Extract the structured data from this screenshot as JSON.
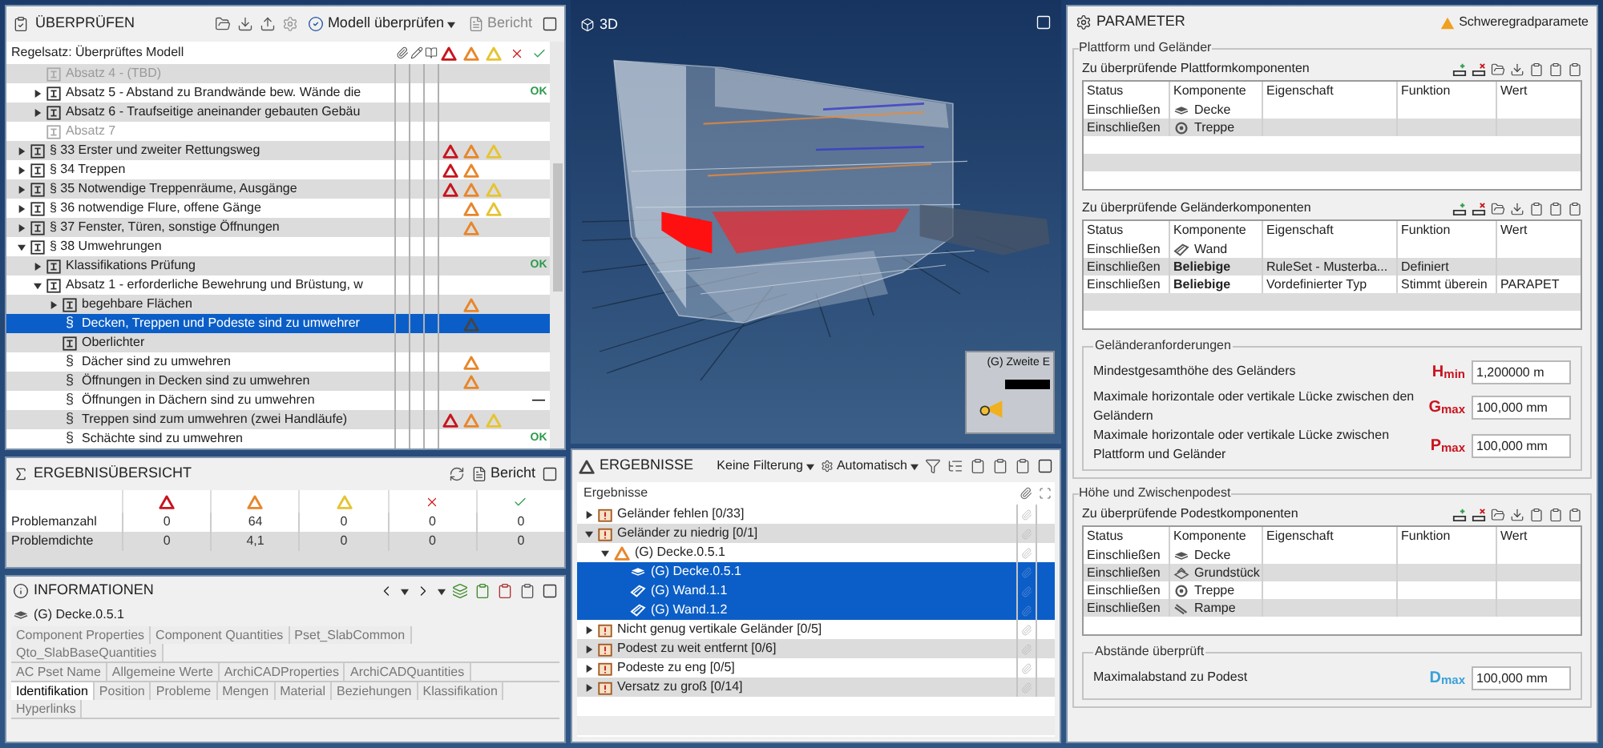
{
  "check_panel": {
    "title": "ÜBERPRÜFEN",
    "check_button": "Modell überprüfen",
    "report_button": "Bericht",
    "ruleset_label": "Regelsatz: Überprüftes Modell",
    "continued_rows": [
      {
        "label": "Absatz 4 - (TBD)",
        "kind": "group",
        "disabled": true,
        "selected": false,
        "issues": {
          "critical": false,
          "major": false,
          "minor": false
        }
      },
      {
        "label": "Absatz 5 - Abstand zu Brandwände bew. Wände die",
        "kind": "group",
        "expanded": false,
        "disabled": false,
        "selected": false,
        "issues": {
          "critical": false,
          "major": false,
          "minor": false
        },
        "status": {
          "text": "OK",
          "kind": "passed"
        }
      },
      {
        "label": "Absatz 6 - Traufseitige aneinander gebauten Gebäu",
        "kind": "group",
        "expanded": false,
        "disabled": false,
        "selected": false,
        "issues": {
          "critical": false,
          "major": false,
          "minor": false
        }
      },
      {
        "label": "Absatz 7",
        "kind": "group",
        "disabled": true,
        "selected": false,
        "issues": {
          "critical": false,
          "major": false,
          "minor": false
        }
      }
    ],
    "tree": [
      {
        "label": "§ 33 Erster und zweiter Rettungsweg",
        "kind": "group",
        "expanded": false,
        "disabled": false,
        "selected": false,
        "issues": {
          "critical": true,
          "major": true,
          "minor": true
        }
      },
      {
        "label": "§ 34 Treppen",
        "kind": "group",
        "expanded": false,
        "disabled": false,
        "selected": false,
        "issues": {
          "critical": true,
          "major": true,
          "minor": false
        }
      },
      {
        "label": "§ 35 Notwendige Treppenräume, Ausgänge",
        "kind": "group",
        "expanded": false,
        "disabled": false,
        "selected": false,
        "issues": {
          "critical": true,
          "major": true,
          "minor": true
        }
      },
      {
        "label": "§ 36 notwendige Flure, offene Gänge",
        "kind": "group",
        "expanded": false,
        "disabled": false,
        "selected": false,
        "issues": {
          "critical": false,
          "major": true,
          "minor": true
        }
      },
      {
        "label": "§ 37 Fenster, Türen, sonstige Öffnungen",
        "kind": "group",
        "expanded": false,
        "disabled": false,
        "selected": false,
        "issues": {
          "critical": false,
          "major": true,
          "minor": false
        }
      },
      {
        "label": "§ 38 Umwehrungen",
        "kind": "group",
        "expanded": true,
        "disabled": false,
        "selected": false,
        "issues": {
          "critical": false,
          "major": false,
          "minor": false
        },
        "children": [
          {
            "label": "Klassifikations Prüfung",
            "kind": "group",
            "expanded": false,
            "disabled": false,
            "selected": false,
            "issues": {
              "critical": false,
              "major": false,
              "minor": false
            },
            "status": {
              "text": "OK",
              "kind": "passed"
            }
          },
          {
            "label": "Absatz 1 - erforderliche Bewehrung und Brüstung, w",
            "kind": "group",
            "expanded": true,
            "disabled": false,
            "selected": false,
            "issues": {
              "critical": false,
              "major": false,
              "minor": false
            },
            "children": [
              {
                "label": "begehbare Flächen",
                "kind": "group",
                "expanded": false,
                "disabled": false,
                "selected": false,
                "issues": {
                  "critical": false,
                  "major": true,
                  "minor": false
                }
              },
              {
                "label": "Decken, Treppen und Podeste sind zu umwehrer",
                "kind": "rule",
                "marker": "§",
                "disabled": false,
                "selected": true,
                "issues": {
                  "critical": false,
                  "major": true,
                  "minor": false
                }
              },
              {
                "label": "Oberlichter",
                "kind": "group",
                "disabled": false,
                "selected": false,
                "issues": {
                  "critical": false,
                  "major": false,
                  "minor": false
                }
              },
              {
                "label": "Dächer sind zu umwehren",
                "kind": "rule",
                "marker": "§",
                "disabled": false,
                "selected": false,
                "issues": {
                  "critical": false,
                  "major": true,
                  "minor": false
                }
              },
              {
                "label": "Öffnungen in Decken sind zu umwehren",
                "kind": "rule",
                "marker": "§",
                "disabled": false,
                "selected": false,
                "issues": {
                  "critical": false,
                  "major": true,
                  "minor": false
                }
              },
              {
                "label": "Öffnungen in Dächern sind zu umwehren",
                "kind": "rule",
                "marker": "§",
                "disabled": false,
                "selected": false,
                "issues": {
                  "critical": false,
                  "major": false,
                  "minor": false
                },
                "status": {
                  "text": "—",
                  "kind": "not-applicable"
                }
              },
              {
                "label": "Treppen sind zum umwehren (zwei Handläufe)",
                "kind": "rule",
                "marker": "§",
                "disabled": false,
                "selected": false,
                "issues": {
                  "critical": true,
                  "major": true,
                  "minor": true
                }
              },
              {
                "label": "Schächte sind zu umwehren",
                "kind": "rule",
                "marker": "§",
                "disabled": false,
                "selected": false,
                "issues": {
                  "critical": false,
                  "major": false,
                  "minor": false
                },
                "status": {
                  "text": "OK",
                  "kind": "passed"
                }
              }
            ]
          }
        ]
      }
    ]
  },
  "summary_panel": {
    "title": "ERGEBNISÜBERSICHT",
    "report_button": "Bericht",
    "rows": [
      {
        "label": "Problemanzahl",
        "values": [
          "0",
          "64",
          "0",
          "0",
          "0"
        ]
      },
      {
        "label": "Problemdichte",
        "values": [
          "0",
          "4,1",
          "0",
          "0",
          "0"
        ]
      }
    ]
  },
  "info_panel": {
    "title": "INFORMATIONEN",
    "element": "(G) Decke.0.5.1",
    "tab_rows": [
      [
        {
          "label": "Component Properties",
          "selected": false
        },
        {
          "label": "Component Quantities",
          "selected": false
        },
        {
          "label": "Pset_SlabCommon",
          "selected": false
        },
        {
          "label": "Qto_SlabBaseQuantities",
          "selected": false
        }
      ],
      [
        {
          "label": "AC Pset Name",
          "selected": false
        },
        {
          "label": "Allgemeine Werte",
          "selected": false
        },
        {
          "label": "ArchiCADProperties",
          "selected": false
        },
        {
          "label": "ArchiCADQuantities",
          "selected": false
        }
      ],
      [
        {
          "label": "Identifikation",
          "selected": true
        },
        {
          "label": "Position",
          "selected": false
        },
        {
          "label": "Probleme",
          "selected": false
        },
        {
          "label": "Mengen",
          "selected": false
        },
        {
          "label": "Material",
          "selected": false
        },
        {
          "label": "Beziehungen",
          "selected": false
        },
        {
          "label": "Klassifikation",
          "selected": false
        },
        {
          "label": "Hyperlinks",
          "selected": false
        }
      ]
    ]
  },
  "viewport": {
    "title": "3D",
    "minimap": {
      "title": "(G) Zweite E"
    }
  },
  "results_panel": {
    "title": "ERGEBNISSE",
    "filter": "Keine Filterung",
    "mode": "Automatisch",
    "column": "Ergebnisse",
    "tree": [
      {
        "label": "Geländer fehlen [0/33]",
        "kind": "category",
        "expanded": false,
        "selected": false
      },
      {
        "label": "Geländer zu niedrig [0/1]",
        "kind": "category",
        "expanded": true,
        "selected": false,
        "children": [
          {
            "label": "(G) Decke.0.5.1",
            "kind": "issue",
            "expanded": true,
            "selected": false,
            "children": [
              {
                "label": "(G) Decke.0.5.1",
                "kind": "slab",
                "selected": true
              },
              {
                "label": "(G) Wand.1.1",
                "kind": "wall",
                "selected": true
              },
              {
                "label": "(G) Wand.1.2",
                "kind": "wall",
                "selected": true
              }
            ]
          }
        ]
      },
      {
        "label": "Nicht genug vertikale Geländer [0/5]",
        "kind": "category",
        "expanded": false,
        "selected": false
      },
      {
        "label": "Podest zu weit entfernt [0/6]",
        "kind": "category",
        "expanded": false,
        "selected": false
      },
      {
        "label": "Podeste zu eng [0/5]",
        "kind": "category",
        "expanded": false,
        "selected": false
      },
      {
        "label": "Versatz zu groß [0/14]",
        "kind": "category",
        "expanded": false,
        "selected": false
      }
    ]
  },
  "parameter_panel": {
    "title": "PARAMETER",
    "severity_button": "Schweregradparamete",
    "sections": [
      {
        "title": "Plattform und Geländer",
        "tables": [
          {
            "title": "Zu überprüfende Plattformkomponenten",
            "columns": [
              "Status",
              "Komponente",
              "Eigenschaft",
              "Funktion",
              "Wert"
            ],
            "rows": [
              {
                "status": "Einschließen",
                "component": "Decke",
                "kind": "slab"
              },
              {
                "status": "Einschließen",
                "component": "Treppe",
                "kind": "stair"
              }
            ]
          },
          {
            "title": "Zu überprüfende Geländerkomponenten",
            "columns": [
              "Status",
              "Komponente",
              "Eigenschaft",
              "Funktion",
              "Wert"
            ],
            "rows": [
              {
                "status": "Einschließen",
                "component": "Wand",
                "kind": "wall"
              },
              {
                "status": "Einschließen",
                "component": "Beliebige",
                "kind": "any",
                "property": "RuleSet - Musterba...",
                "function": "Definiert"
              },
              {
                "status": "Einschließen",
                "component": "Beliebige",
                "kind": "any",
                "property": "Vordefinierter Typ",
                "function": "Stimmt überein",
                "value": "PARAPET"
              }
            ]
          }
        ],
        "field_group": {
          "title": "Geländeranforderungen",
          "fields": [
            {
              "label": "Mindestgesamthöhe des Geländers",
              "symbol": "H$_{min}$",
              "color": "#c8141e",
              "value": "1,200000 m"
            },
            {
              "label": "Maximale horizontale oder vertikale Lücke zwischen den Geländern",
              "symbol": "G$_{max}$",
              "color": "#c8141e",
              "value": "100,000 mm"
            },
            {
              "label": "Maximale horizontale oder vertikale Lücke zwischen Plattform und Geländer",
              "symbol": "P$_{max}$",
              "color": "#c8141e",
              "value": "100,000 mm"
            }
          ]
        }
      },
      {
        "title": "Höhe und Zwischenpodest",
        "tables": [
          {
            "title": "Zu überprüfende Podestkomponenten",
            "columns": [
              "Status",
              "Komponente",
              "Eigenschaft",
              "Funktion",
              "Wert"
            ],
            "rows": [
              {
                "status": "Einschließen",
                "component": "Decke",
                "kind": "slab"
              },
              {
                "status": "Einschließen",
                "component": "Grundstück",
                "kind": "site"
              },
              {
                "status": "Einschließen",
                "component": "Treppe",
                "kind": "stair"
              },
              {
                "status": "Einschließen",
                "component": "Rampe",
                "kind": "ramp"
              }
            ]
          }
        ],
        "field_group": {
          "title": "Abstände überprüft",
          "fields": [
            {
              "label": "Maximalabstand zu Podest",
              "symbol": "D$_{max}$",
              "color": "#3aa0d8",
              "value": "100,000 mm"
            }
          ]
        }
      }
    ]
  }
}
